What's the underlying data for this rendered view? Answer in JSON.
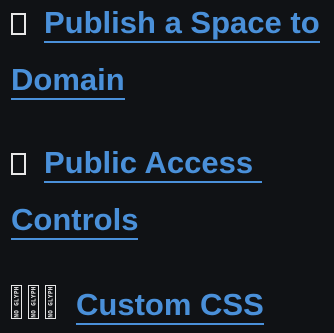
{
  "sections": [
    {
      "icon": "missing-glyph-icon",
      "title_line1": "Publish a Space to",
      "title_line2": "Domain"
    },
    {
      "icon": "missing-glyph-icon",
      "title_line1": "Public Access",
      "title_line2": "Controls"
    },
    {
      "icon": "no-glyph-icon",
      "no_glyph_text": "NO GLYPH",
      "title": "Custom CSS"
    }
  ],
  "colors": {
    "background": "#101215",
    "link": "#4a90d9",
    "icon": "#e8e8e8"
  }
}
